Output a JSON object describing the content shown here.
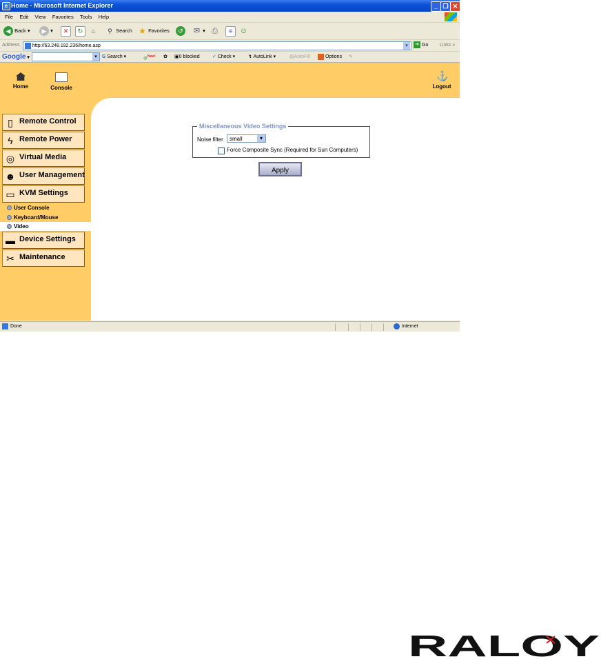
{
  "window": {
    "title": "Home - Microsoft Internet Explorer"
  },
  "menu": [
    "File",
    "Edit",
    "View",
    "Favorites",
    "Tools",
    "Help"
  ],
  "toolbar": {
    "back": "Back",
    "search": "Search",
    "favorites": "Favorites"
  },
  "address": {
    "label": "Address",
    "url": "http://63.248.192.236/home.asp",
    "go": "Go",
    "links": "Links"
  },
  "google_bar": {
    "logo": "Google",
    "search": "Search",
    "new_badge": "New!",
    "blocked": "0 blocked",
    "check": "Check",
    "autolink": "AutoLink",
    "autofill": "AutoFill",
    "options": "Options"
  },
  "top_nav": {
    "home": "Home",
    "console": "Console",
    "logout": "Logout"
  },
  "sidebar": {
    "items": [
      {
        "label": "Remote Control",
        "icon": "remote-control-icon"
      },
      {
        "label": "Remote Power",
        "icon": "power-icon"
      },
      {
        "label": "Virtual Media",
        "icon": "cd-icon"
      },
      {
        "label": "User Management",
        "icon": "users-icon"
      },
      {
        "label": "KVM Settings",
        "icon": "computer-icon"
      },
      {
        "label": "Device Settings",
        "icon": "device-icon"
      },
      {
        "label": "Maintenance",
        "icon": "tools-icon"
      }
    ],
    "subitems": [
      "User Console",
      "Keyboard/Mouse",
      "Video"
    ],
    "selected_subitem": "Video"
  },
  "video_settings": {
    "legend": "Miscellaneous Video Settings",
    "noise_filter_label": "Noise filter",
    "noise_filter_value": "small",
    "force_sync_label": "Force Composite Sync (Required for Sun Computers)",
    "force_sync_checked": false,
    "apply_label": "Apply"
  },
  "status": {
    "text": "Done",
    "zone": "Internet"
  },
  "brand": {
    "name": "RALOY",
    "accent": "#d61f26"
  },
  "colors": {
    "page_bg": "#ffcc66",
    "sidebar_item_bg": "#ffe6bf",
    "titlebar": "#0a52d8"
  }
}
